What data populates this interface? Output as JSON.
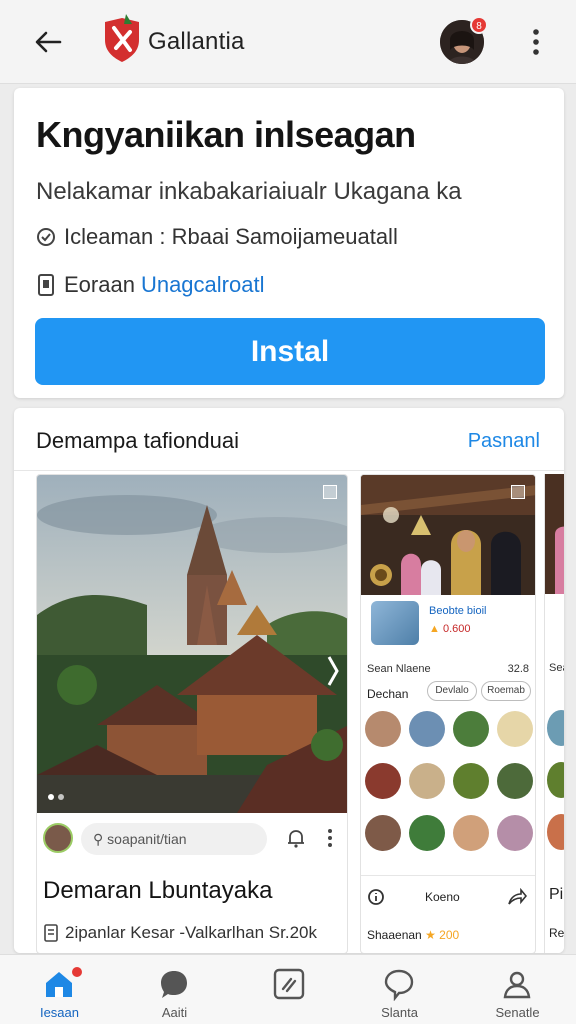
{
  "header": {
    "app_title": "Gallantia",
    "avatar_badge": "8"
  },
  "app_card": {
    "headline": "Kngyaniikan inlseagan",
    "subtitle": "Nelakamar inkabakariaiualr Ukagana ka",
    "info_row_1": "Icleaman : Rbaai Samoijameuatall",
    "info_row_2_prefix": "Eoraan",
    "info_row_2_link": "Unagcalroatl",
    "install_label": "Instal"
  },
  "section": {
    "title": "Demampa tafionduai",
    "link": "Pasnanl"
  },
  "main_tile": {
    "comment_placeholder": "soapanit/tian",
    "title": "Demaran Lbuntayaka",
    "meta": "2ipanlar Kesar -Valkarlhan Sr.20k"
  },
  "side_tile": {
    "product_name": "Beobte bioil",
    "product_price": "0.600",
    "line_label": "Sean Nlaene",
    "line_value": "32.8",
    "filter_label": "Dechan",
    "chips": [
      "Devlalo",
      "Roemab"
    ],
    "bottom_label": "Koeno",
    "bottom_name": "Shaaenan",
    "bottom_rating": "★ 200"
  },
  "peek_tile": {
    "line_label": "Sea",
    "bottom_label": "Pi",
    "bottom_name": "Re"
  },
  "bottom_nav": [
    {
      "label": "Iesaan",
      "icon": "home-icon"
    },
    {
      "label": "Aaiti",
      "icon": "chat-bubble-icon"
    },
    {
      "label": "",
      "icon": "edit-square-icon"
    },
    {
      "label": "Slanta",
      "icon": "speech-icon"
    },
    {
      "label": "Senatle",
      "icon": "profile-icon"
    }
  ],
  "colors": {
    "accent": "#2196f3",
    "link": "#1e88e5",
    "badge": "#e53935",
    "logo_red": "#d32f2f",
    "logo_green": "#2e7d32"
  }
}
